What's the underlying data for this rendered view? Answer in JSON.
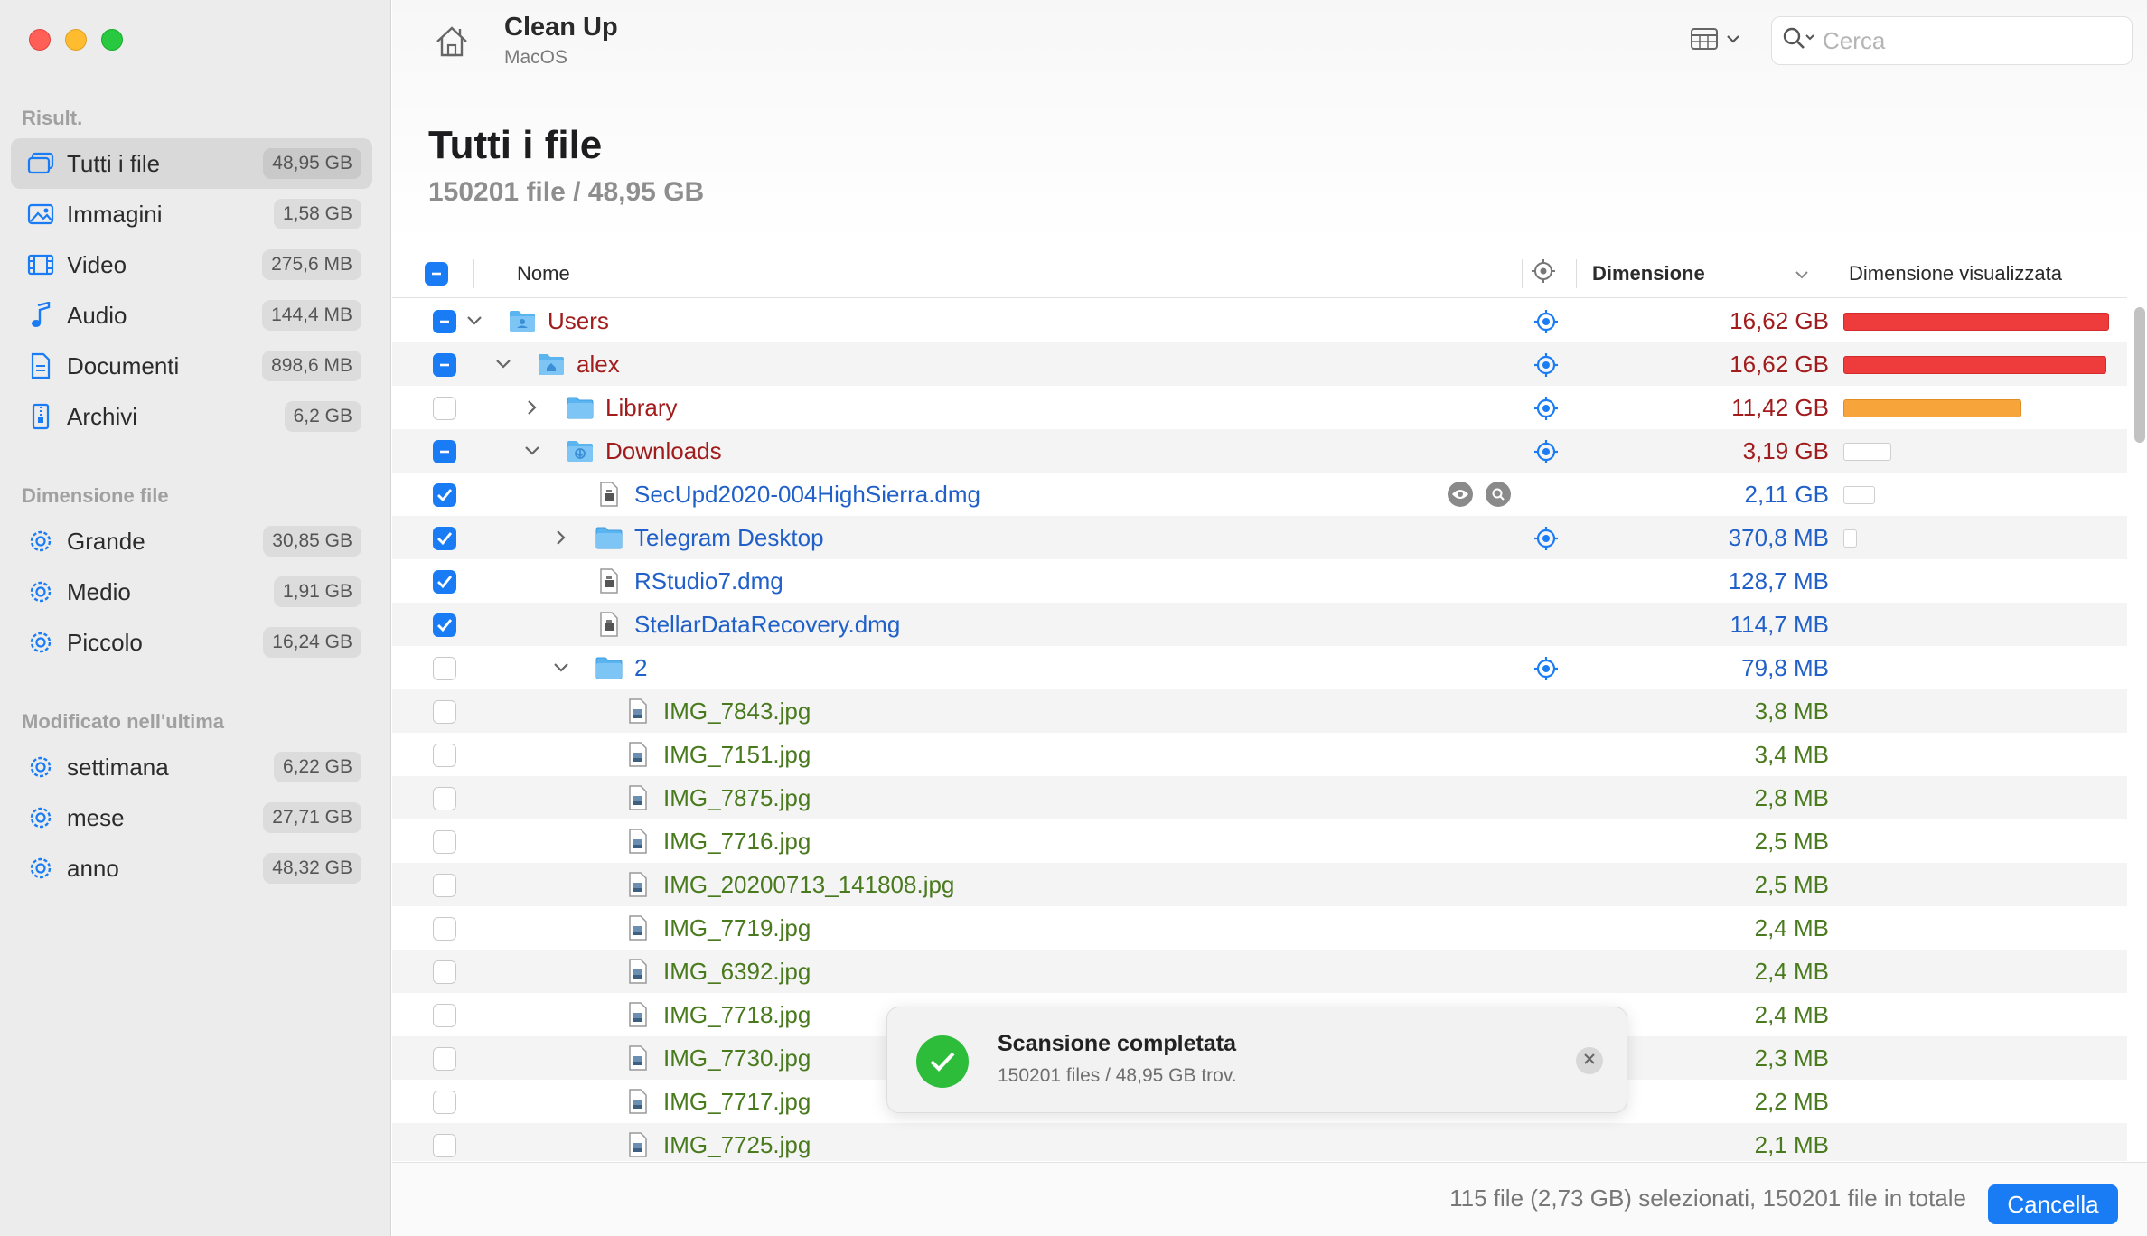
{
  "sidebar": {
    "sections": [
      {
        "title": "Risult.",
        "items": [
          {
            "label": "Tutti i file",
            "badge": "48,95 GB",
            "icon": "files-icon",
            "active": true
          },
          {
            "label": "Immagini",
            "badge": "1,58 GB",
            "icon": "image-icon"
          },
          {
            "label": "Video",
            "badge": "275,6 MB",
            "icon": "film-icon"
          },
          {
            "label": "Audio",
            "badge": "144,4 MB",
            "icon": "music-note-icon"
          },
          {
            "label": "Documenti",
            "badge": "898,6 MB",
            "icon": "document-icon"
          },
          {
            "label": "Archivi",
            "badge": "6,2 GB",
            "icon": "archive-icon"
          }
        ]
      },
      {
        "title": "Dimensione file",
        "items": [
          {
            "label": "Grande",
            "badge": "30,85 GB",
            "icon": "gear-icon"
          },
          {
            "label": "Medio",
            "badge": "1,91 GB",
            "icon": "gear-icon"
          },
          {
            "label": "Piccolo",
            "badge": "16,24 GB",
            "icon": "gear-icon"
          }
        ]
      },
      {
        "title": "Modificato nell'ultima",
        "items": [
          {
            "label": "settimana",
            "badge": "6,22 GB",
            "icon": "gear-icon"
          },
          {
            "label": "mese",
            "badge": "27,71 GB",
            "icon": "gear-icon"
          },
          {
            "label": "anno",
            "badge": "48,32 GB",
            "icon": "gear-icon"
          }
        ]
      }
    ]
  },
  "header": {
    "app_title": "Clean Up",
    "app_subtitle": "MacOS",
    "search_placeholder": "Cerca",
    "page_title": "Tutti i file",
    "page_subtitle": "150201 file / 48,95 GB"
  },
  "table": {
    "col_name": "Nome",
    "col_size": "Dimensione",
    "col_visual": "Dimensione visualizzata",
    "rows": [
      {
        "name": "Users",
        "size": "16,62 GB",
        "check": "mixed",
        "indent": 0,
        "disclosure": "open",
        "type": "folder-user",
        "color": "red",
        "locate": true,
        "bar": "red",
        "bar_frac": 1.0
      },
      {
        "name": "alex",
        "size": "16,62 GB",
        "check": "mixed",
        "indent": 1,
        "disclosure": "open",
        "type": "folder-home",
        "color": "red",
        "locate": true,
        "bar": "red",
        "bar_frac": 0.99
      },
      {
        "name": "Library",
        "size": "11,42 GB",
        "check": "none",
        "indent": 2,
        "disclosure": "closed",
        "type": "folder",
        "color": "red",
        "locate": true,
        "bar": "orange",
        "bar_frac": 0.67
      },
      {
        "name": "Downloads",
        "size": "3,19 GB",
        "check": "mixed",
        "indent": 2,
        "disclosure": "open",
        "type": "folder-download",
        "color": "red",
        "locate": true,
        "bar": "empty",
        "bar_frac": 0.18
      },
      {
        "name": "SecUpd2020-004HighSierra.dmg",
        "size": "2,11 GB",
        "check": "on",
        "indent": 3,
        "disclosure": "none",
        "type": "file",
        "color": "blue",
        "actions": true,
        "bar": "empty",
        "bar_frac": 0.12
      },
      {
        "name": "Telegram Desktop",
        "size": "370,8 MB",
        "check": "on",
        "indent": 3,
        "disclosure": "closed",
        "type": "folder",
        "color": "blue",
        "locate": true,
        "bar": "empty",
        "bar_frac": 0.05
      },
      {
        "name": "RStudio7.dmg",
        "size": "128,7 MB",
        "check": "on",
        "indent": 3,
        "disclosure": "none",
        "type": "file",
        "color": "blue"
      },
      {
        "name": "StellarDataRecovery.dmg",
        "size": "114,7 MB",
        "check": "on",
        "indent": 3,
        "disclosure": "none",
        "type": "file",
        "color": "blue"
      },
      {
        "name": "2",
        "size": "79,8 MB",
        "check": "none",
        "indent": 3,
        "disclosure": "open",
        "type": "folder",
        "color": "blue",
        "locate": true
      },
      {
        "name": "IMG_7843.jpg",
        "size": "3,8 MB",
        "check": "none",
        "indent": 4,
        "disclosure": "none",
        "type": "image-file",
        "color": "green"
      },
      {
        "name": "IMG_7151.jpg",
        "size": "3,4 MB",
        "check": "none",
        "indent": 4,
        "disclosure": "none",
        "type": "image-file",
        "color": "green"
      },
      {
        "name": "IMG_7875.jpg",
        "size": "2,8 MB",
        "check": "none",
        "indent": 4,
        "disclosure": "none",
        "type": "image-file",
        "color": "green"
      },
      {
        "name": "IMG_7716.jpg",
        "size": "2,5 MB",
        "check": "none",
        "indent": 4,
        "disclosure": "none",
        "type": "image-file",
        "color": "green"
      },
      {
        "name": "IMG_20200713_141808.jpg",
        "size": "2,5 MB",
        "check": "none",
        "indent": 4,
        "disclosure": "none",
        "type": "image-file",
        "color": "green"
      },
      {
        "name": "IMG_7719.jpg",
        "size": "2,4 MB",
        "check": "none",
        "indent": 4,
        "disclosure": "none",
        "type": "image-file",
        "color": "green"
      },
      {
        "name": "IMG_6392.jpg",
        "size": "2,4 MB",
        "check": "none",
        "indent": 4,
        "disclosure": "none",
        "type": "image-file",
        "color": "green"
      },
      {
        "name": "IMG_7718.jpg",
        "size": "2,4 MB",
        "check": "none",
        "indent": 4,
        "disclosure": "none",
        "type": "image-file",
        "color": "green"
      },
      {
        "name": "IMG_7730.jpg",
        "size": "2,3 MB",
        "check": "none",
        "indent": 4,
        "disclosure": "none",
        "type": "image-file",
        "color": "green"
      },
      {
        "name": "IMG_7717.jpg",
        "size": "2,2 MB",
        "check": "none",
        "indent": 4,
        "disclosure": "none",
        "type": "image-file",
        "color": "green"
      },
      {
        "name": "IMG_7725.jpg",
        "size": "2,1 MB",
        "check": "none",
        "indent": 4,
        "disclosure": "none",
        "type": "image-file",
        "color": "green"
      }
    ]
  },
  "toast": {
    "title": "Scansione completata",
    "subtitle": "150201 files / 48,95 GB trov."
  },
  "footer": {
    "status": "115 file (2,73 GB) selezionati, 150201 file in totale",
    "cancel_label": "Cancella"
  },
  "colors": {
    "accent": "#1a7cf5",
    "red_text": "#a11d1d",
    "blue_text": "#2060c8",
    "green_text": "#4a7a1e",
    "bar_red": "#ee3b3b",
    "bar_orange": "#f7a43a",
    "success": "#2ebd3b"
  }
}
